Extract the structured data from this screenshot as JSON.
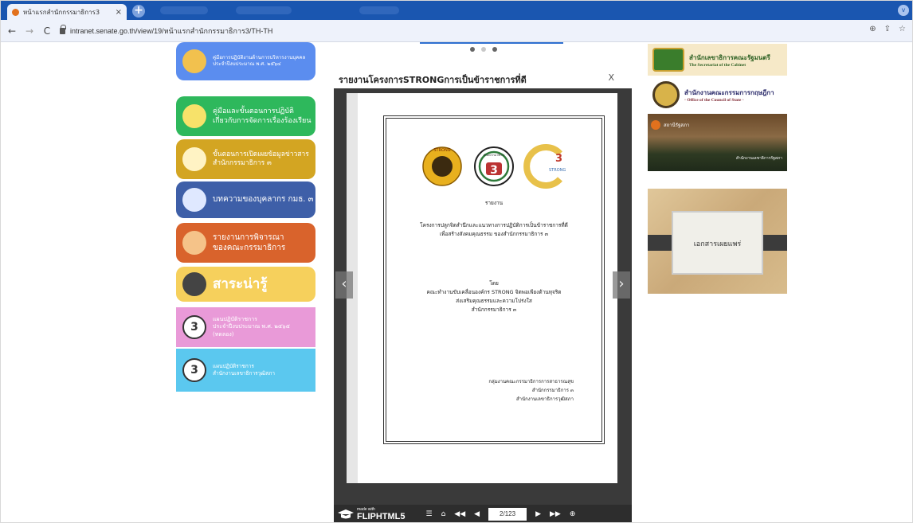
{
  "browser": {
    "tab_title": "หน้าแรกสำนักกรรมาธิการ3",
    "tab_close": "×",
    "new_tab": "+",
    "url": "intranet.senate.go.th/view/19/หน้าแรกสำนักกรรมาธิการ3/TH-TH",
    "dropdown": "v"
  },
  "left_menu": [
    {
      "label": "คู่มือการปฏิบัติงานด้านการบริหารงานบุคคล\nประจำปีงบประมาณ พ.ศ. ๒๕๖๔",
      "color": "#5b8def",
      "icon_color": "#f2c14e",
      "icon": "books"
    },
    {
      "label": "คู่มือและขั้นตอนการปฏิบัติ\nเกี่ยวกับการจัดการเรื่องร้องเรียน",
      "color": "#2eb85c",
      "icon_color": "#f7e26a",
      "icon": "manual"
    },
    {
      "label": "ขั้นตอนการเปิดเผยข้อมูลข่าวสาร\nสำนักกรรมาธิการ ๓",
      "color": "#d3a522",
      "icon_color": "#fff3c4",
      "icon": "clipboard"
    },
    {
      "label": "บทความของบุคลากร กมธ. ๓",
      "color": "#3e5fa8",
      "icon_color": "#dfe8ff",
      "icon": "article"
    },
    {
      "label": "รายงานการพิจารณา\nของคณะกรรมาธิการ",
      "color": "#d9632c",
      "icon_color": "#f5c389",
      "icon": "books"
    },
    {
      "label": "สาระน่ารู้",
      "color": "#f6d05c",
      "icon_color": "#444",
      "icon": "bulb"
    },
    {
      "label": "แผนปฏิบัติราชการ\nประจำปีงบประมาณ พ.ศ. ๒๕๖๕\n(ทดลอง)",
      "color": "#e99ad8",
      "icon_color": "#ffffff",
      "icon": "3"
    },
    {
      "label": "แผนปฏิบัติราชการ\nสำนักงานเลขาธิการวุฒิสภา",
      "color": "#5bc8ef",
      "icon_color": "#ffffff",
      "icon": "3"
    }
  ],
  "modal": {
    "title": "รายงานโครงการSTRONGการเป็นข้าราชการที่ดี",
    "close": "X",
    "document": {
      "heading": "รายงาน",
      "project_line1": "โครงการปลูกจิตสำนึกและแนวทางการปฏิบัติการเป็นข้าราชการที่ดี",
      "project_line2": "เพื่อสร้างสังคมคุณธรรม ของสำนักกรรมาธิการ ๓",
      "by": "โดย",
      "team_line1": "คณะทำงานขับเคลื่อนองค์กร STRONG จิตพอเพียงต้านทุจริต",
      "team_line2": "ส่งเสริมคุณธรรมและความโปร่งใส",
      "team_line3": "สำนักกรรมาธิการ ๓",
      "sig_line1": "กลุ่มงานคณะกรรมาธิการการสาธารณสุข",
      "sig_line2": "สำนักกรรมาธิการ ๓",
      "sig_line3": "สำนักงานเลขาธิการวุฒิสภา",
      "logo1_text": "STRONG",
      "logo2_text": "สำนักกรรมาธิการ",
      "logo2_number": "3",
      "logo3_text": "STRONG",
      "logo3_number": "3"
    },
    "prev": "‹",
    "next": "›",
    "brand_small": "made with",
    "brand": "FLIPHTML5",
    "page_indicator": "2/123"
  },
  "right_column": {
    "cabinet_title": "สำนักเลขาธิการคณะรัฐมนตรี",
    "cabinet_sub": "The Secretariat of the Cabinet",
    "council_title": "สำนักงานคณะกรรมการกฤษฎีกา",
    "council_sub": "◦ Office of the Council of State ◦",
    "parliament_text": "สถานีรัฐสภา",
    "parliament_sub": "สำนักงานเลขาธิการรัฐสภา",
    "publications": "เอกสารเผยแพร่"
  }
}
